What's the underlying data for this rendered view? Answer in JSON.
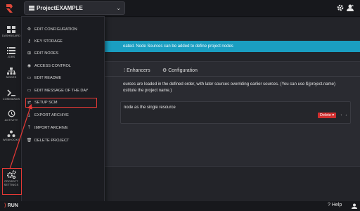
{
  "topbar": {
    "project_name": "ProjectEXAMPLE"
  },
  "sidenav": {
    "items": [
      {
        "label": "DASHBOARD",
        "icon": "dashboard-icon"
      },
      {
        "label": "JOBS",
        "icon": "list-icon"
      },
      {
        "label": "NODES",
        "icon": "sitemap-icon"
      },
      {
        "label": "COMMANDS",
        "icon": "terminal-icon"
      },
      {
        "label": "ACTIVITY",
        "icon": "history-icon"
      },
      {
        "label": "WEBHOOKS",
        "icon": "webhook-icon"
      },
      {
        "label_line1": "PROJECT",
        "label_line2": "SETTINGS",
        "icon": "cogs-icon"
      }
    ]
  },
  "menu": {
    "items": [
      {
        "label": "EDIT CONFIGURATION",
        "icon": "gear-icon",
        "glyph": "⚙"
      },
      {
        "label": "KEY STORAGE",
        "icon": "key-icon",
        "glyph": "⚷"
      },
      {
        "label": "EDIT NODES",
        "icon": "sitemap-icon",
        "glyph": "⊞"
      },
      {
        "label": "ACCESS CONTROL",
        "icon": "shield-icon",
        "glyph": "◉"
      },
      {
        "label": "EDIT README",
        "icon": "file-icon",
        "glyph": "▭"
      },
      {
        "label": "EDIT MESSAGE OF THE DAY",
        "icon": "file-icon",
        "glyph": "▭"
      },
      {
        "label": "SETUP SCM",
        "icon": "exchange-icon",
        "glyph": "⇄"
      },
      {
        "label": "EXPORT ARCHIVE",
        "icon": "download-icon",
        "glyph": "⤓"
      },
      {
        "label": "IMPORT ARCHIVE",
        "icon": "upload-icon",
        "glyph": "⤒"
      },
      {
        "label": "DELETE PROJECT",
        "icon": "trash-icon",
        "glyph": "🗑"
      }
    ]
  },
  "main": {
    "alert_text": "eated. Node Sources can be added to define project nodes",
    "tabs": [
      {
        "label": "Enhancers",
        "icon": "enhancer-icon"
      },
      {
        "label": "Configuration",
        "icon": "gear-icon"
      }
    ],
    "description": "ources are loaded in the defined order, with later sources overriding earlier sources. (You can use ${project.name) ostitute the project name.)",
    "source_text": "node as the single resource",
    "delete_label": "Delete",
    "up_glyph": "↑",
    "down_glyph": "↓"
  },
  "footer": {
    "brand": "RUN",
    "help_label": "Help"
  },
  "colors": {
    "accent": "#1a9ec1",
    "danger": "#d12f2f",
    "annotation": "#e53935",
    "brand": "#e0483a"
  }
}
